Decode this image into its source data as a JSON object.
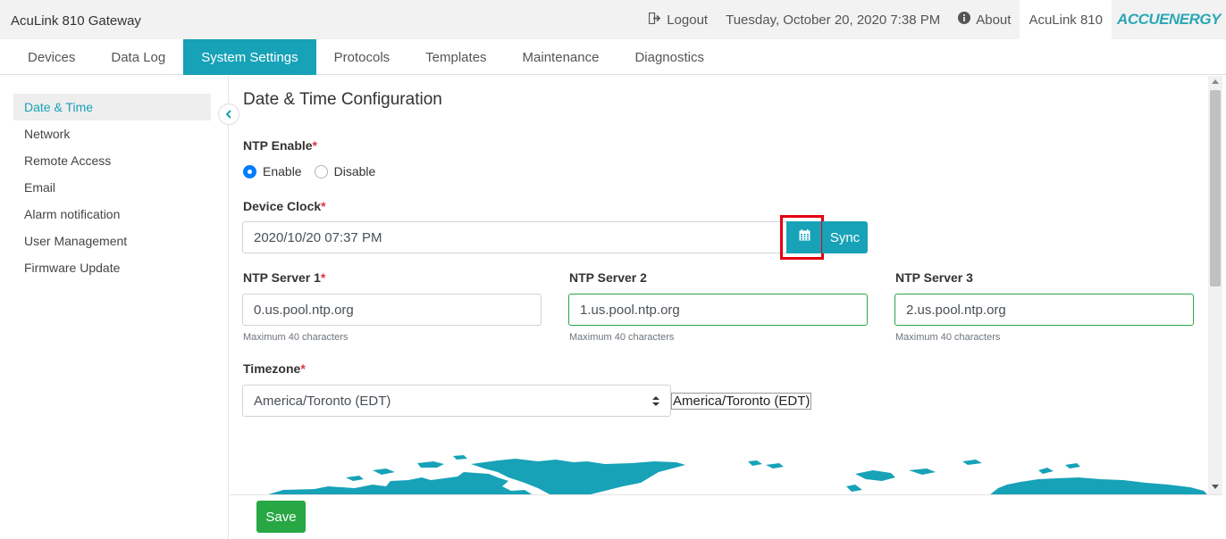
{
  "header": {
    "app_title": "AcuLink 810 Gateway",
    "logout_label": "Logout",
    "datetime": "Tuesday, October 20, 2020 7:38 PM",
    "about_label": "About",
    "device_name": "AcuLink 810",
    "brand": "ACCUENERGY"
  },
  "nav": {
    "tabs": [
      {
        "label": "Devices"
      },
      {
        "label": "Data Log"
      },
      {
        "label": "System Settings",
        "active": true
      },
      {
        "label": "Protocols"
      },
      {
        "label": "Templates"
      },
      {
        "label": "Maintenance"
      },
      {
        "label": "Diagnostics"
      }
    ]
  },
  "sidebar": {
    "items": [
      {
        "label": "Date & Time",
        "active": true
      },
      {
        "label": "Network"
      },
      {
        "label": "Remote Access"
      },
      {
        "label": "Email"
      },
      {
        "label": "Alarm notification"
      },
      {
        "label": "User Management"
      },
      {
        "label": "Firmware Update"
      }
    ]
  },
  "main": {
    "title": "Date & Time Configuration",
    "ntp_enable": {
      "label": "NTP Enable",
      "required": "*",
      "options": [
        "Enable",
        "Disable"
      ],
      "selected": "Enable"
    },
    "device_clock": {
      "label": "Device Clock",
      "required": "*",
      "value": "2020/10/20 07:37 PM",
      "sync_label": "Sync"
    },
    "ntp_servers": [
      {
        "label": "NTP Server 1",
        "required": "*",
        "value": "0.us.pool.ntp.org",
        "hint": "Maximum 40 characters"
      },
      {
        "label": "NTP Server 2",
        "required": "",
        "value": "1.us.pool.ntp.org",
        "hint": "Maximum 40 characters"
      },
      {
        "label": "NTP Server 3",
        "required": "",
        "value": "2.us.pool.ntp.org",
        "hint": "Maximum 40 characters"
      }
    ],
    "timezone": {
      "label": "Timezone",
      "required": "*",
      "selected": "America/Toronto (EDT)",
      "display": "America/Toronto (EDT)"
    }
  },
  "footer": {
    "save_label": "Save"
  },
  "colors": {
    "accent": "#17a2b8",
    "save": "#28a745",
    "highlight": "#e3000f",
    "valid_border": "#28a745",
    "map": "#17a2b8"
  },
  "icons": {
    "logout": "logout-icon",
    "about": "info-icon",
    "calendar": "calendar-icon",
    "collapse": "chevron-left-icon",
    "select": "select-arrows-icon"
  }
}
